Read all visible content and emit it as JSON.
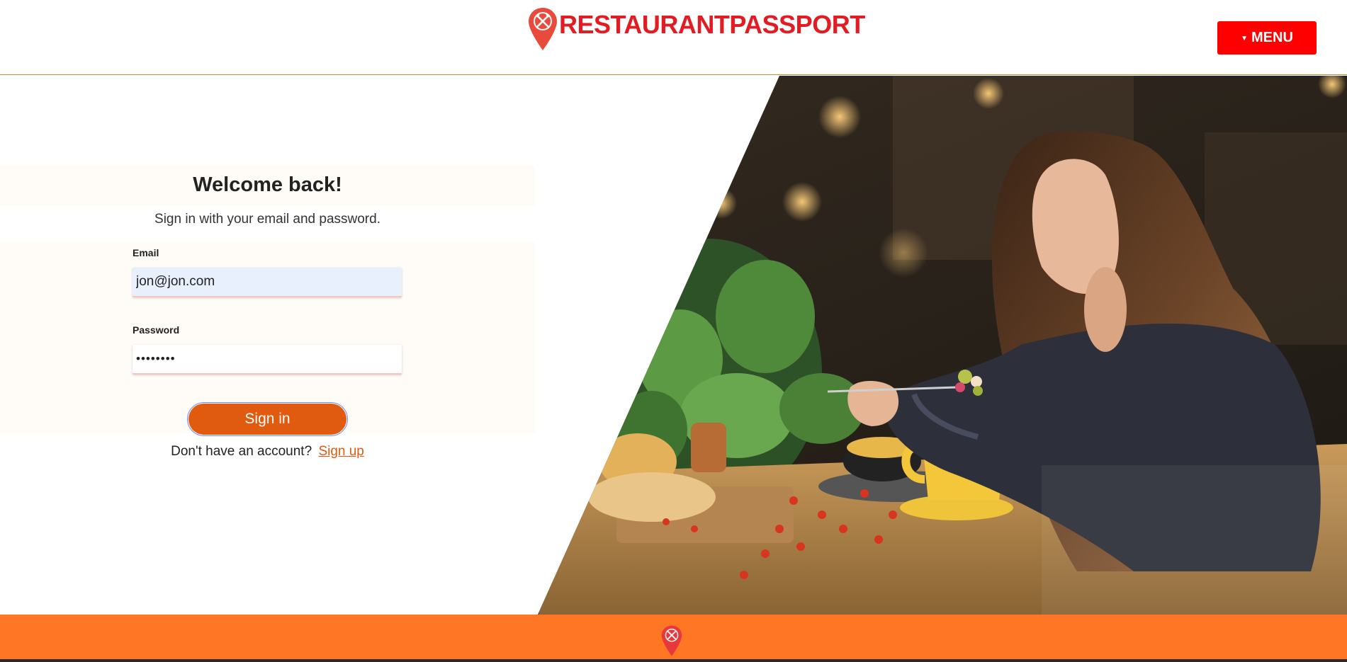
{
  "header": {
    "brand_name": "RESTAURANTPASSPORT",
    "logo_icon": "map-pin-fork-knife-icon",
    "menu_label": "MENU",
    "menu_icon": "caret-down-icon"
  },
  "signin": {
    "title": "Welcome back!",
    "subtitle": "Sign in with your email and password.",
    "email_label": "Email",
    "email_value": "jon@jon.com",
    "password_label": "Password",
    "password_value": "••••••••",
    "submit_label": "Sign in",
    "no_account_text": "Don't have an account?",
    "signup_label": "Sign up"
  },
  "hero": {
    "image": "woman-eating-at-restaurant-photo"
  },
  "footer": {
    "logo_icon": "map-pin-fork-knife-icon"
  },
  "colors": {
    "brand_red": "#e31b23",
    "menu_red": "#ff0000",
    "accent_orange": "#e05a0f",
    "footer_orange": "#ff7624"
  }
}
